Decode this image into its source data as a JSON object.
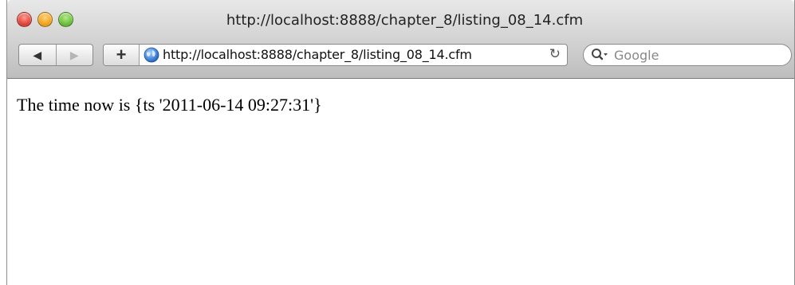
{
  "window": {
    "title": "http://localhost:8888/chapter_8/listing_08_14.cfm"
  },
  "toolbar": {
    "back_icon": "back-arrow-icon",
    "forward_icon": "forward-arrow-icon",
    "add_bookmark_icon": "plus-icon",
    "site_icon": "globe-icon",
    "address_value": "http://localhost:8888/chapter_8/listing_08_14.cfm",
    "reload_icon": "reload-icon",
    "search_placeholder": "Google",
    "search_icon": "magnifier-dropdown-icon"
  },
  "page": {
    "body_text": "The time now is {ts '2011-06-14 09:27:31'}"
  }
}
